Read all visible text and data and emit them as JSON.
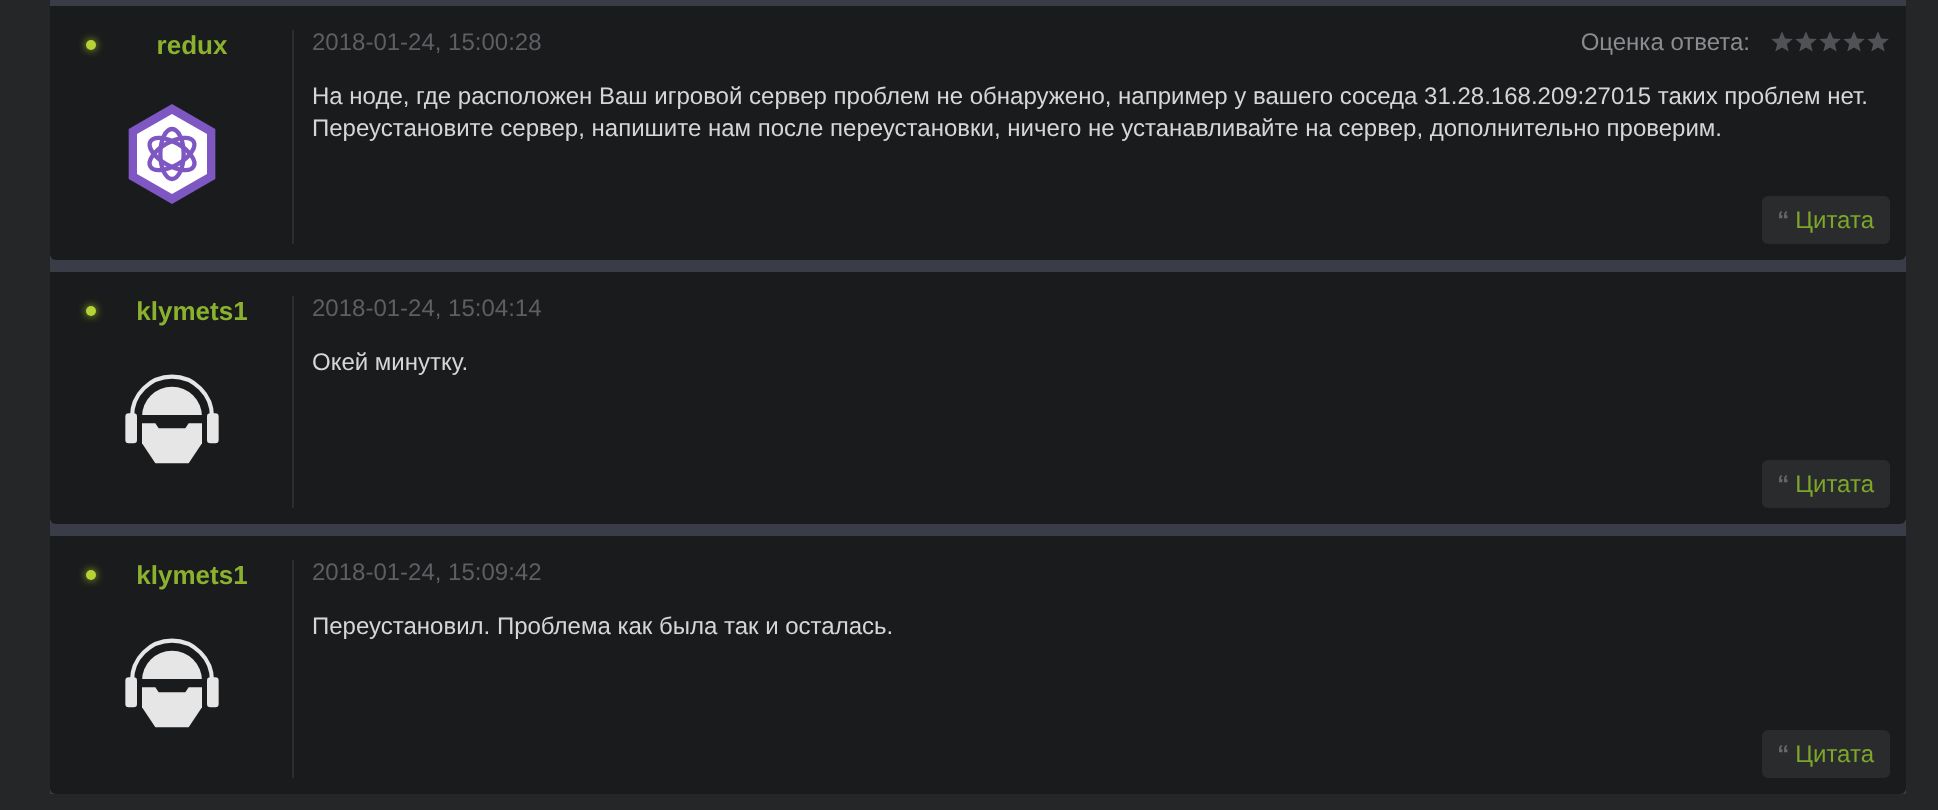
{
  "posts": [
    {
      "author": "redux",
      "online": true,
      "avatar": {
        "kind": "hex-logo"
      },
      "date": "2018-01-24, 15:00:28",
      "rating": {
        "label": "Оценка ответа:",
        "stars": 0
      },
      "text": [
        "На ноде, где расположен Ваш игровой сервер проблем не обнаружено, например у вашего соседа 31.28.168.209:27015 таких проблем нет.",
        "Переустановите сервер, напишите нам после переустановки, ничего не устанавливайте на сервер, дополнительно проверим."
      ],
      "quote": {
        "mark": "“",
        "label": "Цитата"
      }
    },
    {
      "author": "klymets1",
      "online": true,
      "avatar": {
        "kind": "headphones"
      },
      "date": "2018-01-24, 15:04:14",
      "text": [
        "Окей минутку."
      ],
      "quote": {
        "mark": "“",
        "label": "Цитата"
      }
    },
    {
      "author": "klymets1",
      "online": true,
      "avatar": {
        "kind": "headphones"
      },
      "date": "2018-01-24, 15:09:42",
      "text": [
        "Переустановил. Проблема как была так и осталась."
      ],
      "quote": {
        "mark": "“",
        "label": "Цитата"
      }
    }
  ]
}
